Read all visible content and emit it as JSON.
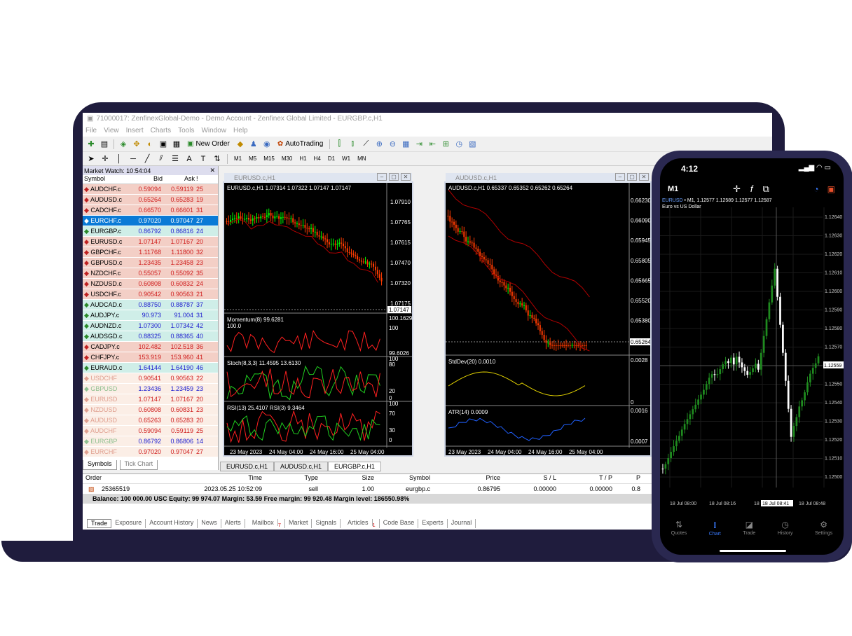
{
  "window": {
    "title": "71000017: ZenfinexGlobal-Demo - Demo Account - Zenfinex Global Limited - EURGBP.c,H1",
    "menu": [
      "File",
      "View",
      "Insert",
      "Charts",
      "Tools",
      "Window",
      "Help"
    ]
  },
  "toolbar": {
    "new_order": "New Order",
    "auto_trading": "AutoTrading",
    "timeframes": [
      "M1",
      "M5",
      "M15",
      "M30",
      "H1",
      "H4",
      "D1",
      "W1",
      "MN"
    ]
  },
  "market_watch": {
    "header": "Market Watch: 10:54:04",
    "columns": [
      "Symbol",
      "Bid",
      "Ask",
      "!"
    ],
    "rows": [
      {
        "symbol": "AUDCHF.c",
        "bid": "0.59094",
        "ask": "0.59119",
        "spread": "25",
        "style": "red"
      },
      {
        "symbol": "AUDUSD.c",
        "bid": "0.65264",
        "ask": "0.65283",
        "spread": "19",
        "style": "red"
      },
      {
        "symbol": "CADCHF.c",
        "bid": "0.66570",
        "ask": "0.66601",
        "spread": "31",
        "style": "red"
      },
      {
        "symbol": "EURCHF.c",
        "bid": "0.97020",
        "ask": "0.97047",
        "spread": "27",
        "style": "selected"
      },
      {
        "symbol": "EURGBP.c",
        "bid": "0.86792",
        "ask": "0.86816",
        "spread": "24",
        "style": "blue"
      },
      {
        "symbol": "EURUSD.c",
        "bid": "1.07147",
        "ask": "1.07167",
        "spread": "20",
        "style": "red"
      },
      {
        "symbol": "GBPCHF.c",
        "bid": "1.11768",
        "ask": "1.11800",
        "spread": "32",
        "style": "red"
      },
      {
        "symbol": "GBPUSD.c",
        "bid": "1.23435",
        "ask": "1.23458",
        "spread": "23",
        "style": "red"
      },
      {
        "symbol": "NZDCHF.c",
        "bid": "0.55057",
        "ask": "0.55092",
        "spread": "35",
        "style": "red"
      },
      {
        "symbol": "NZDUSD.c",
        "bid": "0.60808",
        "ask": "0.60832",
        "spread": "24",
        "style": "red"
      },
      {
        "symbol": "USDCHF.c",
        "bid": "0.90542",
        "ask": "0.90563",
        "spread": "21",
        "style": "red"
      },
      {
        "symbol": "AUDCAD.c",
        "bid": "0.88750",
        "ask": "0.88787",
        "spread": "37",
        "style": "blue"
      },
      {
        "symbol": "AUDJPY.c",
        "bid": "90.973",
        "ask": "91.004",
        "spread": "31",
        "style": "blue"
      },
      {
        "symbol": "AUDNZD.c",
        "bid": "1.07300",
        "ask": "1.07342",
        "spread": "42",
        "style": "blue"
      },
      {
        "symbol": "AUDSGD.c",
        "bid": "0.88325",
        "ask": "0.88365",
        "spread": "40",
        "style": "blue"
      },
      {
        "symbol": "CADJPY.c",
        "bid": "102.482",
        "ask": "102.518",
        "spread": "36",
        "style": "red"
      },
      {
        "symbol": "CHFJPY.c",
        "bid": "153.919",
        "ask": "153.960",
        "spread": "41",
        "style": "red"
      },
      {
        "symbol": "EURAUD.c",
        "bid": "1.64144",
        "ask": "1.64190",
        "spread": "46",
        "style": "blue"
      },
      {
        "symbol": "USDCHF",
        "bid": "0.90541",
        "ask": "0.90563",
        "spread": "22",
        "style": "faded"
      },
      {
        "symbol": "GBPUSD",
        "bid": "1.23436",
        "ask": "1.23459",
        "spread": "23",
        "style": "faded-blue"
      },
      {
        "symbol": "EURUSD",
        "bid": "1.07147",
        "ask": "1.07167",
        "spread": "20",
        "style": "faded"
      },
      {
        "symbol": "NZDUSD",
        "bid": "0.60808",
        "ask": "0.60831",
        "spread": "23",
        "style": "faded"
      },
      {
        "symbol": "AUDUSD",
        "bid": "0.65263",
        "ask": "0.65283",
        "spread": "20",
        "style": "faded"
      },
      {
        "symbol": "AUDCHF",
        "bid": "0.59094",
        "ask": "0.59119",
        "spread": "25",
        "style": "faded"
      },
      {
        "symbol": "EURGBP",
        "bid": "0.86792",
        "ask": "0.86806",
        "spread": "14",
        "style": "faded-blue"
      },
      {
        "symbol": "EURCHF",
        "bid": "0.97020",
        "ask": "0.97047",
        "spread": "27",
        "style": "faded"
      }
    ],
    "tabs": [
      "Symbols",
      "Tick Chart"
    ]
  },
  "charts": {
    "left": {
      "title": "EURUSD.c,H1",
      "info": "EURUSD.c,H1  1.07314 1.07322 1.07147 1.07147",
      "price_ticks": [
        "1.07910",
        "1.07765",
        "1.07615",
        "1.07470",
        "1.07320",
        "1.07175"
      ],
      "last_price": "1.07147",
      "momentum_label": "Momentum(8) 99.6281",
      "momentum_ticks": [
        "100.1629",
        "100",
        "99.6026"
      ],
      "momentum_base": "100.0",
      "stoch_label": "Stoch(8,3,3) 11.4595 13.6130",
      "stoch_ticks": [
        "100",
        "80",
        "20",
        "0"
      ],
      "rsi_label": "RSI(13) 25.4107  RSI(3) 9.3464",
      "rsi_ticks": [
        "100",
        "70",
        "30",
        "0"
      ],
      "time_ticks": [
        "23 May 2023",
        "24 May 04:00",
        "24 May 16:00",
        "25 May 04:00"
      ]
    },
    "right": {
      "title": "AUDUSD.c,H1",
      "info": "AUDUSD.c,H1  0.65337 0.65352 0.65262 0.65264",
      "price_ticks": [
        "0.66230",
        "0.66090",
        "0.65945",
        "0.65805",
        "0.65665",
        "0.65520",
        "0.65380",
        "0.65235"
      ],
      "last_price": "0.65264",
      "stddev_label": "StdDev(20) 0.0010",
      "stddev_ticks": [
        "0.0028",
        "0"
      ],
      "atr_label": "ATR(14) 0.0009",
      "atr_ticks": [
        "0.0016",
        "0.0007"
      ],
      "time_ticks": [
        "23 May 2023",
        "24 May 04:00",
        "24 May 16:00",
        "25 May 04:00"
      ]
    },
    "tabs": [
      "EURUSD.c,H1",
      "AUDUSD.c,H1",
      "EURGBP.c,H1"
    ]
  },
  "terminal": {
    "columns": [
      "Order",
      "Time",
      "Type",
      "Size",
      "Symbol",
      "Price",
      "S / L",
      "T / P",
      "P"
    ],
    "row": {
      "order": "25365519",
      "time": "2023.05.25 10:52:09",
      "type": "sell",
      "size": "1.00",
      "symbol": "eurgbp.c",
      "price": "0.86795",
      "sl": "0.00000",
      "tp": "0.00000",
      "p": "0.8"
    },
    "balance": "Balance: 100 000.00 USC  Equity: 99 974.07  Margin: 53.59  Free margin: 99 920.48  Margin level: 186550.98%",
    "tabs": [
      "Trade",
      "Exposure",
      "Account History",
      "News",
      "Alerts",
      "Mailbox",
      "Market",
      "Signals",
      "Articles",
      "Code Base",
      "Experts",
      "Journal"
    ],
    "mailbox_badge": "7",
    "articles_badge": "1"
  },
  "phone": {
    "time": "4:12",
    "timeframe": "M1",
    "symbol": "EURUSD",
    "info": " • M1, 1.12577 1.12589 1.12577 1.12587",
    "subtitle": "Euro vs US Dollar",
    "price_ticks": [
      "1.12640",
      "1.12630",
      "1.12620",
      "1.12610",
      "1.12600",
      "1.12590",
      "1.12580",
      "1.12570",
      "1.12559",
      "1.12550",
      "1.12540",
      "1.12530",
      "1.12520",
      "1.12510",
      "1.12500"
    ],
    "cursor_price": "1.12559",
    "time_ticks": [
      "18 Jul 08:00",
      "18 Jul 08:16",
      "18 Jul 08:41",
      "18 Jul 08:48"
    ],
    "time_prefix": "18",
    "nav": [
      {
        "label": "Quotes",
        "icon": "quotes-icon"
      },
      {
        "label": "Chart",
        "icon": "chart-icon"
      },
      {
        "label": "Trade",
        "icon": "trade-icon"
      },
      {
        "label": "History",
        "icon": "history-icon"
      },
      {
        "label": "Settings",
        "icon": "settings-icon"
      }
    ]
  },
  "colors": {
    "laptop": "#1f1c3d",
    "bull": "#00ff00",
    "bear": "#ff3b00",
    "phone_bull": "#1f8b1f",
    "phone_bear": "#ffffff",
    "selected_row": "#0a7ad6"
  }
}
